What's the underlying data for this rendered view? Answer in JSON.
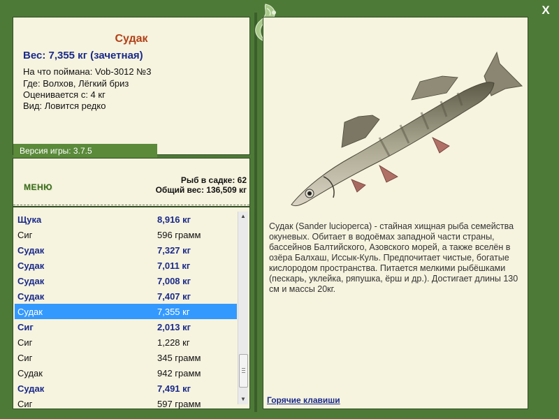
{
  "window": {
    "close_label": "X"
  },
  "fish": {
    "title": "Судак",
    "weight_line": "Вес: 7,355 кг (зачетная)",
    "caught_with": "На что поймана: Vob-3012 №3",
    "where": "Где: Волхов, Лёгкий бриз",
    "rated_from": "Оценивается с: 4 кг",
    "rarity": "Вид: Ловится редко"
  },
  "version": "Версия игры: 3.7.5",
  "menu_label": "меню",
  "cage": {
    "count_line": "Рыб в садке: 62",
    "total_line": "Общий вес: 136,509 кг"
  },
  "catch_list": [
    {
      "name": "Щука",
      "weight": "8,916 кг",
      "bold": true
    },
    {
      "name": "Сиг",
      "weight": "596 грамм",
      "bold": false
    },
    {
      "name": "Судак",
      "weight": "7,327 кг",
      "bold": true
    },
    {
      "name": "Судак",
      "weight": "7,011 кг",
      "bold": true
    },
    {
      "name": "Судак",
      "weight": "7,008 кг",
      "bold": true
    },
    {
      "name": "Судак",
      "weight": "7,407 кг",
      "bold": true
    },
    {
      "name": "Судак",
      "weight": "7,355 кг",
      "bold": true,
      "selected": true
    },
    {
      "name": "Сиг",
      "weight": "2,013 кг",
      "bold": true
    },
    {
      "name": "Сиг",
      "weight": "1,228 кг",
      "bold": false
    },
    {
      "name": "Сиг",
      "weight": "345 грамм",
      "bold": false
    },
    {
      "name": "Судак",
      "weight": "942 грамм",
      "bold": false
    },
    {
      "name": "Судак",
      "weight": "7,491 кг",
      "bold": true
    },
    {
      "name": "Сиг",
      "weight": "597 грамм",
      "bold": false
    }
  ],
  "description": "Судак (Sander lucioperca) - стайная хищная рыба семейства окуневых. Обитает в водоёмах западной части страны, бассейнов Балтийского, Азовского морей, а также вселён в озёра Балхаш, Иссык-Куль. Предпочитает чистые, богатые кислородом пространства. Питается мелкими рыбёшками (пескарь, уклейка, ряпушка, ёрш и др.). Достигает длины 130 см и массы 20кг.",
  "hotkeys_label": "Горячие клавиши",
  "colors": {
    "frame_green": "#4e7a38",
    "panel_bg": "#f6f3df",
    "title_orange": "#b24016",
    "text_blue": "#1a2a8a",
    "selection_blue": "#3399ff"
  }
}
